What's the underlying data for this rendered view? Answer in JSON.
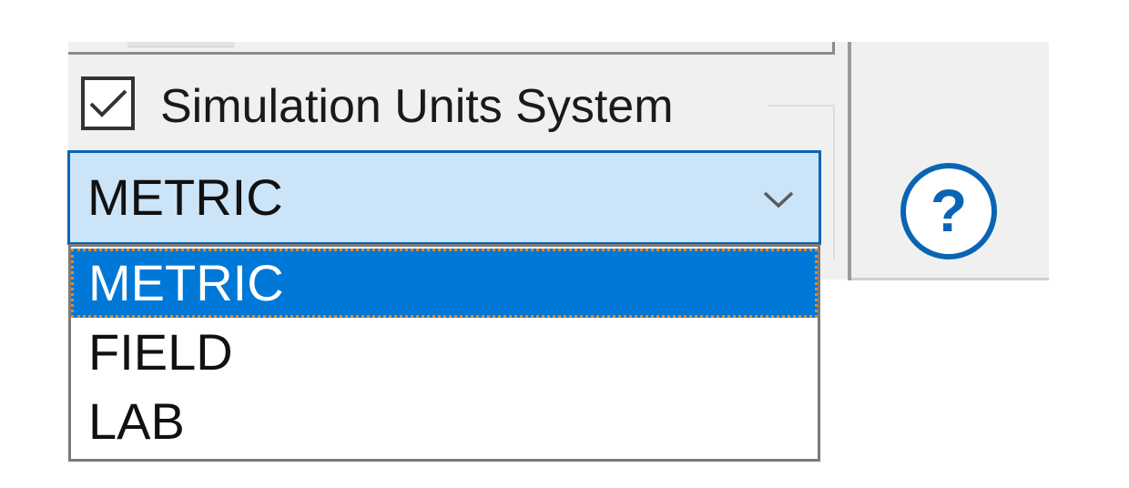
{
  "group": {
    "checkbox_checked": true,
    "caption": "Simulation Units System"
  },
  "combo": {
    "selected_value": "METRIC",
    "arrow_icon": "chevron-down-icon"
  },
  "dropdown": {
    "options": [
      {
        "label": "METRIC",
        "selected": true
      },
      {
        "label": "FIELD",
        "selected": false
      },
      {
        "label": "LAB",
        "selected": false
      }
    ]
  },
  "help": {
    "icon": "help-icon",
    "glyph": "?"
  },
  "colors": {
    "accent": "#0078d7",
    "combo_bg": "#cce4f7",
    "combo_border": "#0a64b4",
    "focus_outline": "#e08a2a",
    "panel_bg": "#f0f0f0",
    "help_icon": "#0a64b4"
  }
}
